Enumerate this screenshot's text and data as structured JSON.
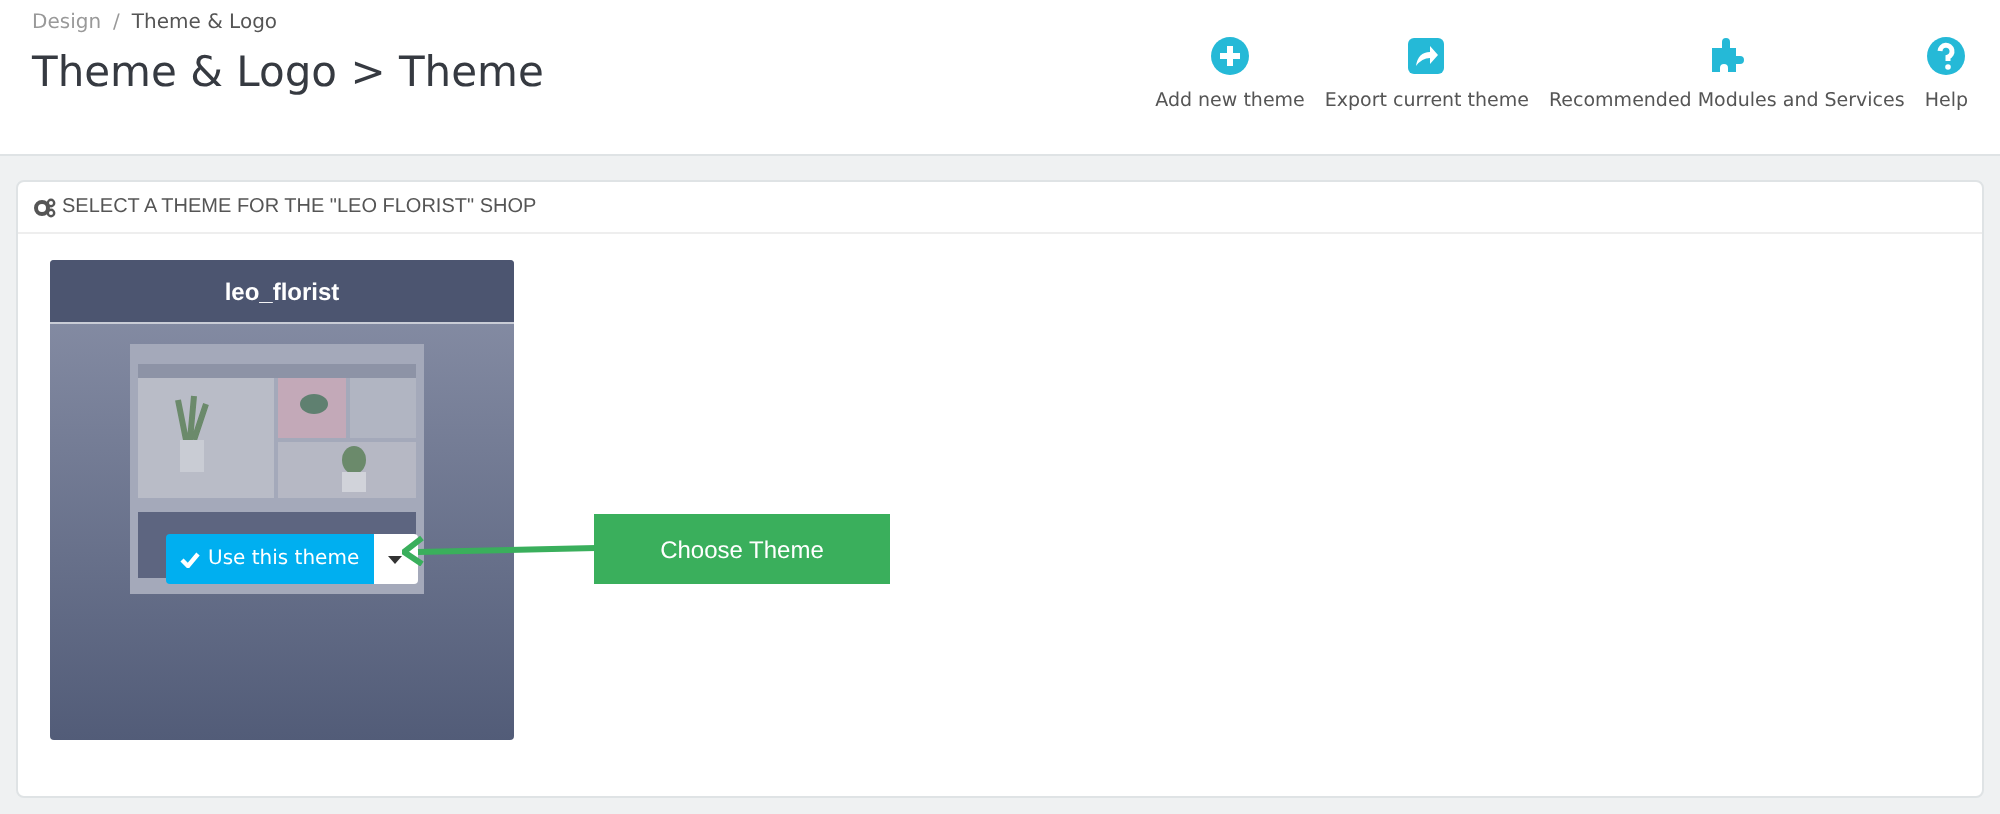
{
  "breadcrumb": [
    "Design",
    "Theme & Logo"
  ],
  "breadcrumb_separator": "/",
  "page_title": "Theme & Logo > Theme",
  "toolbar": [
    {
      "label": "Add new theme",
      "kind": "add"
    },
    {
      "label": "Export current theme",
      "kind": "export"
    },
    {
      "label": "Recommended Modules and Services",
      "kind": "modules"
    },
    {
      "label": "Help",
      "kind": "help"
    }
  ],
  "panel": {
    "heading": "SELECT A THEME FOR THE \"LEO FLORIST\" SHOP",
    "theme": {
      "name": "leo_florist",
      "use_button": "Use this theme"
    }
  },
  "annotation": {
    "label": "Choose Theme"
  }
}
